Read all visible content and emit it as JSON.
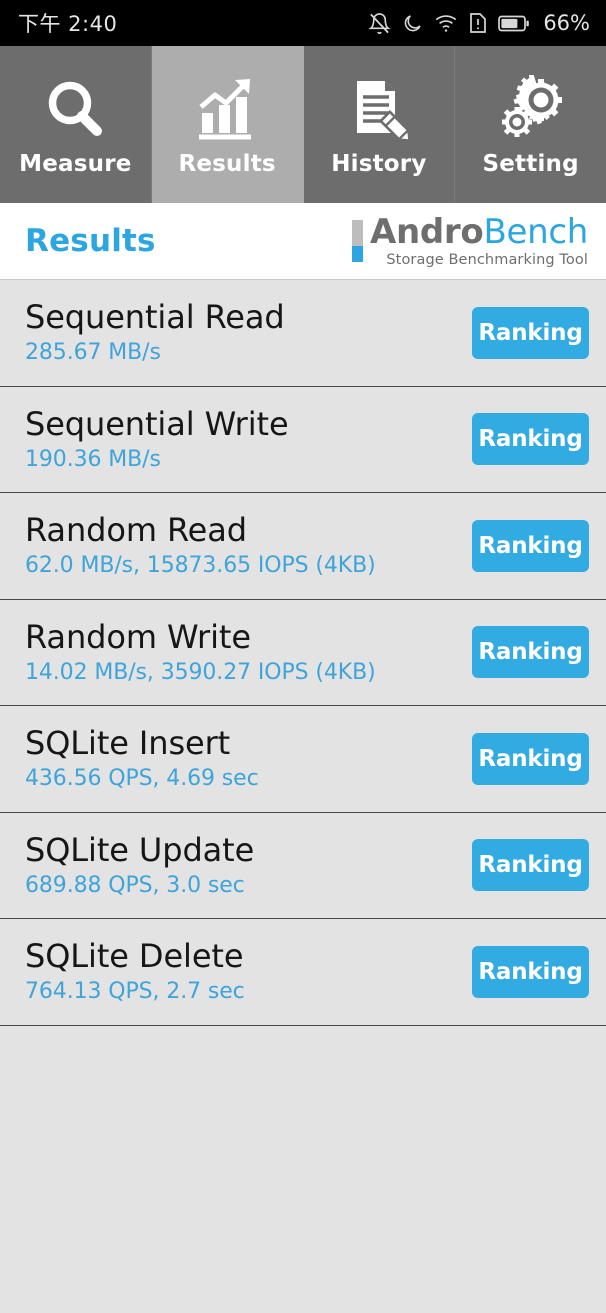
{
  "statusbar": {
    "time": "下午 2:40",
    "battery_percent": "66%",
    "icons": [
      "bell-muted-icon",
      "moon-icon",
      "wifi-icon",
      "sim-alert-icon",
      "battery-icon"
    ]
  },
  "tabs": [
    {
      "label": "Measure",
      "icon": "magnifier-icon",
      "active": false
    },
    {
      "label": "Results",
      "icon": "bar-chart-arrow-icon",
      "active": true
    },
    {
      "label": "History",
      "icon": "document-pencil-icon",
      "active": false
    },
    {
      "label": "Setting",
      "icon": "gears-icon",
      "active": false
    }
  ],
  "header": {
    "title": "Results",
    "logo_andro": "Andro",
    "logo_bench": "Bench",
    "logo_tagline": "Storage Benchmarking Tool"
  },
  "colors": {
    "accent_blue": "#32ABE2",
    "sub_text_blue": "#3FA4DA",
    "tab_inactive": "#6D6D6D",
    "tab_active": "#ADADAD",
    "list_bg": "#E3E3E3"
  },
  "results": [
    {
      "name": "Sequential Read",
      "value": "285.67 MB/s",
      "button": "Ranking"
    },
    {
      "name": "Sequential Write",
      "value": "190.36 MB/s",
      "button": "Ranking"
    },
    {
      "name": "Random Read",
      "value": "62.0 MB/s, 15873.65 IOPS (4KB)",
      "button": "Ranking"
    },
    {
      "name": "Random Write",
      "value": "14.02 MB/s, 3590.27 IOPS (4KB)",
      "button": "Ranking"
    },
    {
      "name": "SQLite Insert",
      "value": "436.56 QPS, 4.69 sec",
      "button": "Ranking"
    },
    {
      "name": "SQLite Update",
      "value": "689.88 QPS, 3.0 sec",
      "button": "Ranking"
    },
    {
      "name": "SQLite Delete",
      "value": "764.13 QPS, 2.7 sec",
      "button": "Ranking"
    }
  ]
}
